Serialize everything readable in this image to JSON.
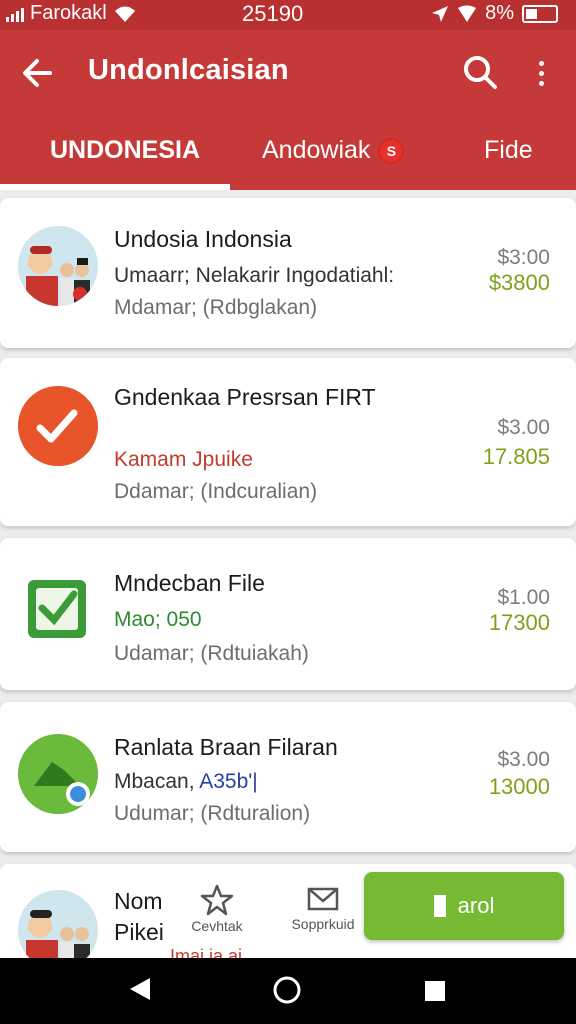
{
  "status_bar": {
    "carrier": "Farokakl",
    "time": "25190",
    "battery": "8%"
  },
  "app_bar": {
    "title": "Undonlcaisian"
  },
  "tabs": [
    {
      "label": "UNDONESIA",
      "active": true
    },
    {
      "label": "Andowiak",
      "badge": "S"
    },
    {
      "label": "Fide"
    }
  ],
  "items": [
    {
      "title": "Undosia Indonsia",
      "subtitle": "Umaarr; Nelakarir Ingodatiahl:",
      "meta": "Mdamar;  (Rdbglakan)",
      "price": "$3:00",
      "amount": "$3800"
    },
    {
      "title": "Gndenkaa Presrsan FIRT",
      "subtitle": "Kamam Jpuike",
      "meta": "Ddamar;  (Indcuralian)",
      "price": "$3.00",
      "amount": "17.805"
    },
    {
      "title": "Mndecban File",
      "subtitle": "Mao; 050",
      "meta": "Udamar;  (Rdtuiakah)",
      "price": "$1.00",
      "amount": "17300"
    },
    {
      "title": "Ranlata Braan Filaran",
      "subtitle_prefix": "Mbacan, ",
      "subtitle_tag": "A35b'|",
      "meta": "Udumar;  (Rdturalion)",
      "price": "$3.00",
      "amount": "13000"
    },
    {
      "title": "Nom Pikei",
      "peek": "Imai ia ai"
    }
  ],
  "actions": {
    "left_label": "Cevhtak",
    "middle_label": "Sopprkuid",
    "cta_label": "arol"
  },
  "colors": {
    "primary": "#c53a38",
    "status_bar": "#b8302f",
    "accent_green": "#76b932",
    "amount_green": "#7da21a",
    "subtitle_red": "#c43b2b"
  }
}
